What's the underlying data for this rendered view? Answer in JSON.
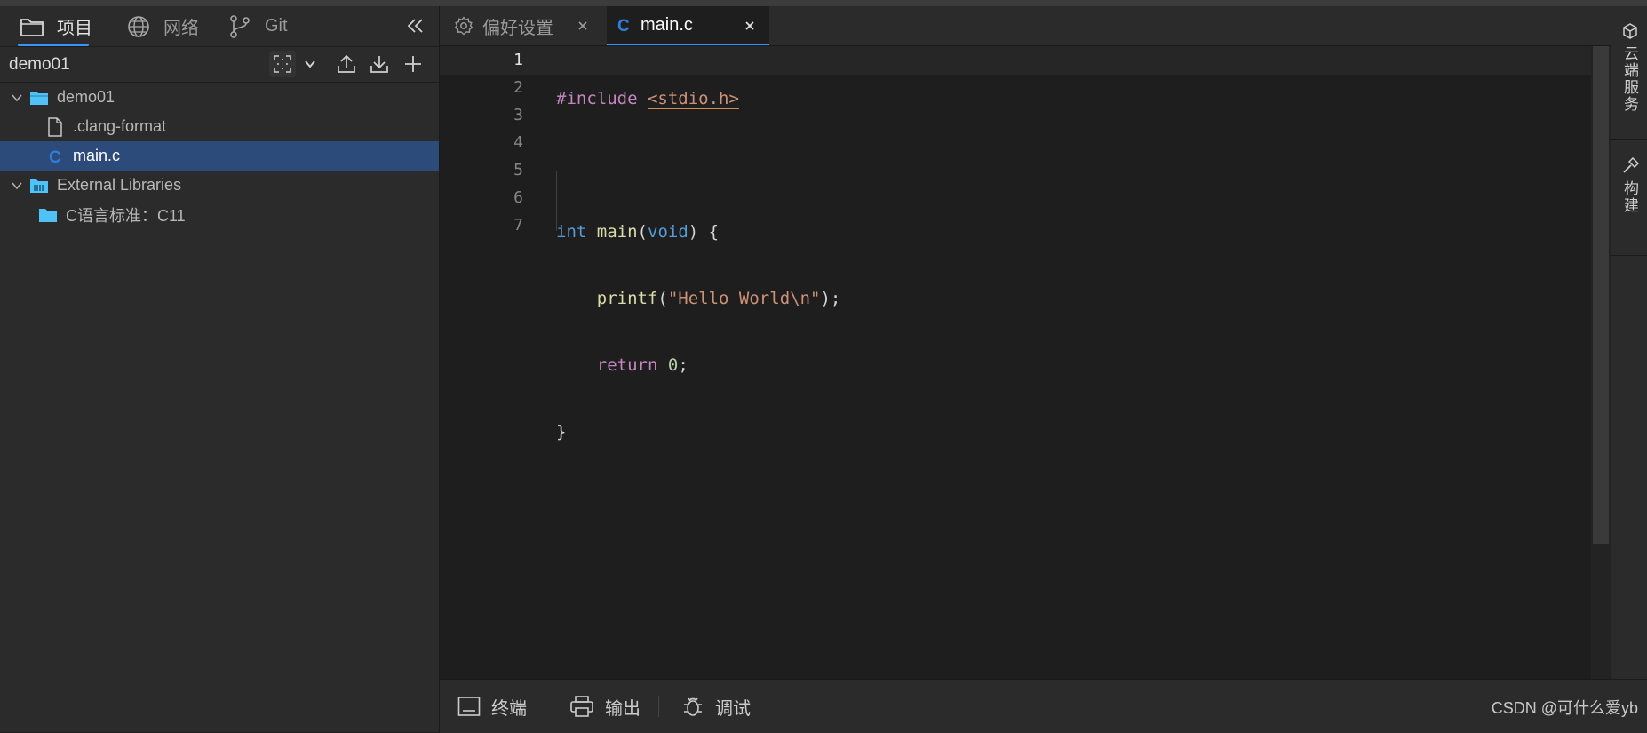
{
  "sidebar_tabs": [
    {
      "label": "项目",
      "icon": "folder-icon",
      "active": true
    },
    {
      "label": "网络",
      "icon": "globe-icon",
      "active": false
    },
    {
      "label": "Git",
      "icon": "git-branch-icon",
      "active": false
    }
  ],
  "project": {
    "name": "demo01"
  },
  "tree": {
    "root": "demo01",
    "file1": ".clang-format",
    "file2": "main.c",
    "libs": "External Libraries",
    "lib_item": "C语言标准：C11"
  },
  "editor_tabs": [
    {
      "label": "偏好设置",
      "icon": "gear-icon",
      "active": false
    },
    {
      "label": "main.c",
      "icon": "c-file-icon",
      "active": true
    }
  ],
  "code": {
    "line_numbers": [
      "1",
      "2",
      "3",
      "4",
      "5",
      "6",
      "7"
    ],
    "l1_directive": "#include",
    "l1_header": "<stdio.h>",
    "l3_type": "int",
    "l3_func": "main",
    "l3_open": "(",
    "l3_void": "void",
    "l3_close": ") {",
    "l4_func": "printf",
    "l4_open": "(",
    "l4_string": "\"Hello World\\n\"",
    "l4_close": ");",
    "l5_return": "return",
    "l5_value": "0",
    "l5_semi": ";",
    "l6_brace": "}"
  },
  "bottom_tabs": [
    {
      "label": "终端",
      "icon": "terminal-icon"
    },
    {
      "label": "输出",
      "icon": "printer-icon"
    },
    {
      "label": "调试",
      "icon": "bug-icon"
    }
  ],
  "right_panel": [
    {
      "label": "云端服务",
      "icon": "cube-icon"
    },
    {
      "label": "构建",
      "icon": "hammer-icon"
    }
  ],
  "watermark": "CSDN @可什么爱yb",
  "colors": {
    "accent": "#3794ff",
    "selection": "#2c4a7a",
    "folder": "#4fc3f7"
  }
}
